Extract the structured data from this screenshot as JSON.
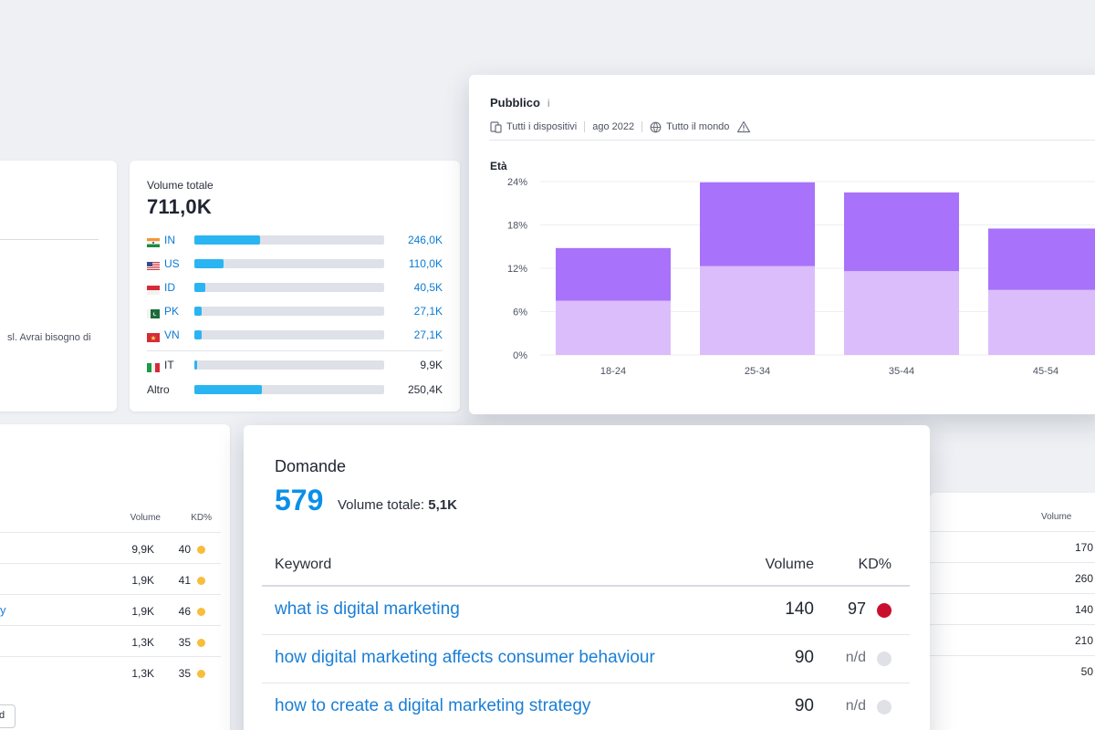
{
  "left_card": {
    "snippet": "sl. Avrai bisogno di"
  },
  "volume_card": {
    "label": "Volume totale",
    "total": "711,0K",
    "countries": [
      {
        "code": "IN",
        "value": "246,0K",
        "share": 0.345,
        "flag": "india-flag-icon"
      },
      {
        "code": "US",
        "value": "110,0K",
        "share": 0.155,
        "flag": "usa-flag-icon"
      },
      {
        "code": "ID",
        "value": "40,5K",
        "share": 0.057,
        "flag": "indonesia-flag-icon"
      },
      {
        "code": "PK",
        "value": "27,1K",
        "share": 0.038,
        "flag": "pakistan-flag-icon"
      },
      {
        "code": "VN",
        "value": "27,1K",
        "share": 0.038,
        "flag": "vietnam-flag-icon"
      }
    ],
    "home_country": {
      "code": "IT",
      "value": "9,9K",
      "share": 0.014,
      "flag": "italy-flag-icon"
    },
    "other": {
      "label": "Altro",
      "value": "250,4K",
      "share": 0.352
    }
  },
  "audience": {
    "title": "Pubblico",
    "info": "i",
    "devices": "Tutti i dispositivi",
    "date": "ago 2022",
    "region": "Tutto il mondo",
    "subtitle": "Età"
  },
  "chart_data": {
    "type": "bar",
    "stacked": true,
    "categories": [
      "18-24",
      "25-34",
      "35-44",
      "45-54"
    ],
    "series": [
      {
        "values": [
          7.5,
          12.3,
          11.6,
          9.0
        ],
        "color": "#dcbdfc"
      },
      {
        "values": [
          7.3,
          11.6,
          10.9,
          8.5
        ],
        "color": "#a872fb"
      }
    ],
    "y_ticks": [
      "0%",
      "6%",
      "12%",
      "18%",
      "24%"
    ],
    "ylim": [
      0,
      24
    ],
    "grid": true
  },
  "bottom_left_table": {
    "col_volume": "Volume",
    "col_kd": "KD%",
    "rows": [
      {
        "volume": "9,9K",
        "kd": "40",
        "color": "#f7bd3b"
      },
      {
        "volume": "1,9K",
        "kd": "41",
        "color": "#f7bd3b"
      },
      {
        "volume": "1,9K",
        "kd": "46",
        "color": "#f7bd3b"
      },
      {
        "volume": "1,3K",
        "kd": "35",
        "color": "#f7bd3b"
      },
      {
        "volume": "1,3K",
        "kd": "35",
        "color": "#f7bd3b"
      }
    ],
    "edge_glyph": "y",
    "cut_button": "d"
  },
  "domande": {
    "title": "Domande",
    "count": "579",
    "volume_label": "Volume totale:",
    "volume_value": "5,1K",
    "col_keyword": "Keyword",
    "col_volume": "Volume",
    "col_kd": "KD%",
    "rows": [
      {
        "keyword": "what is digital marketing",
        "volume": "140",
        "kd": "97",
        "color": "#c8102e"
      },
      {
        "keyword": "how digital marketing affects consumer behaviour",
        "volume": "90",
        "kd": "n/d",
        "color": "#dfe1e6"
      },
      {
        "keyword": "how to create a digital marketing strategy",
        "volume": "90",
        "kd": "n/d",
        "color": "#dfe1e6"
      }
    ]
  },
  "right_table": {
    "col_volume": "Volume",
    "values": [
      "170",
      "260",
      "140",
      "210",
      "50"
    ]
  }
}
